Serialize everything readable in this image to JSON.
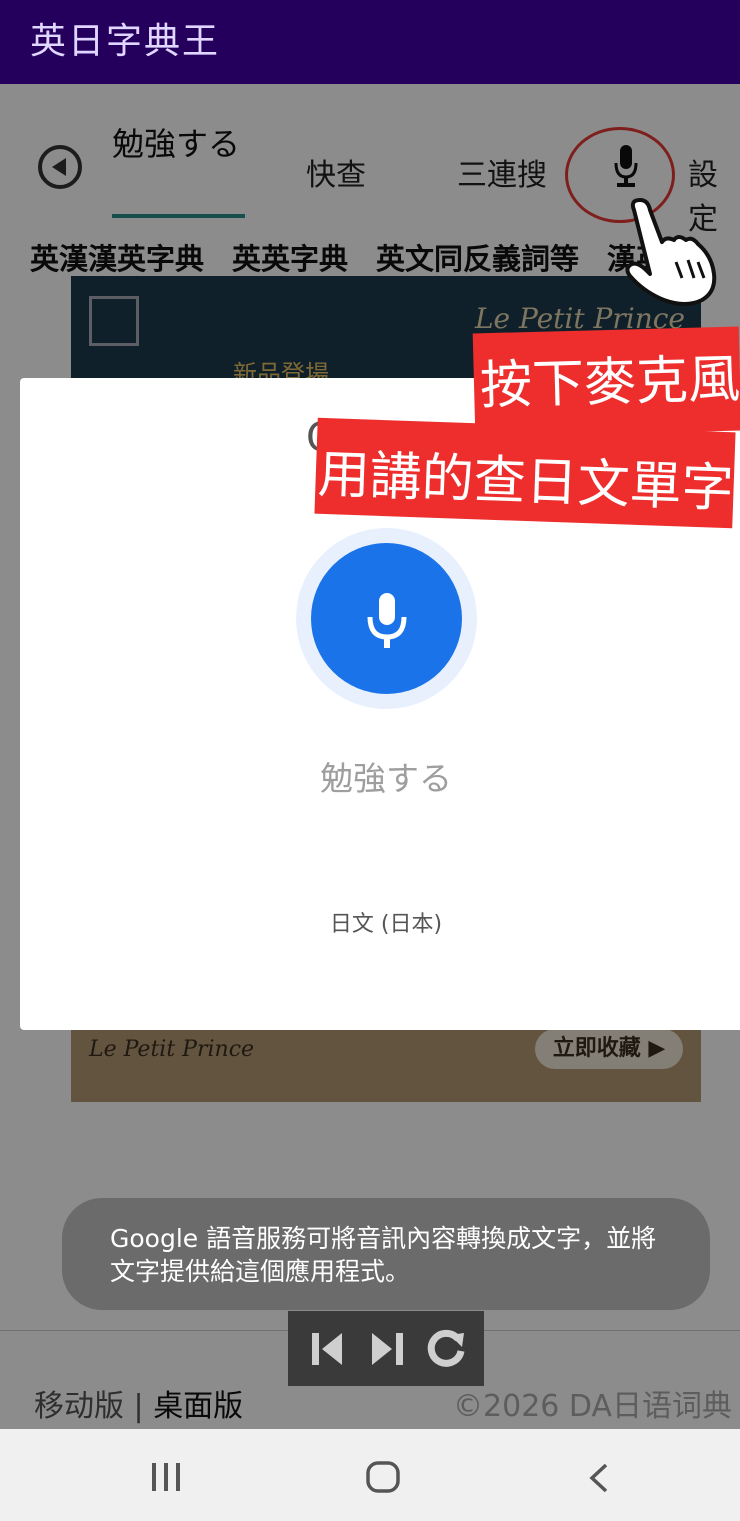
{
  "app": {
    "title": "英日字典王"
  },
  "tabs": [
    {
      "label": "勉強する",
      "active": true
    },
    {
      "label": "快查"
    },
    {
      "label": "三連搜"
    },
    {
      "label": "設定"
    }
  ],
  "dictionaries": [
    "英漢漢英字典",
    "英英字典",
    "英文同反義詞等",
    "漢英"
  ],
  "ad": {
    "brand": "Le Petit Prince",
    "new_label": "新品登場",
    "bottom_brand": "Le Petit Prince",
    "cta": "立即收藏 ▶"
  },
  "footer": {
    "mobile": "移动版",
    "separator": " | ",
    "desktop": "桌面版",
    "copyright": "©2026 DA日语词典"
  },
  "voice_dialog": {
    "logo_partial": "G",
    "recognized_text": "勉強する",
    "language": "日文 (日本)",
    "accent_color": "#1a73e8"
  },
  "toast": {
    "text": "Google 語音服務可將音訊內容轉換成文字，並將文字提供給這個應用程式。"
  },
  "annotations": {
    "line1": "按下麥克風",
    "line2": "用講的查日文單字"
  },
  "icons": [
    "back-arrow-icon",
    "microphone-icon",
    "pointing-hand-icon",
    "skip-previous-icon",
    "skip-next-icon",
    "refresh-icon",
    "recents-icon",
    "home-icon",
    "nav-back-icon"
  ]
}
